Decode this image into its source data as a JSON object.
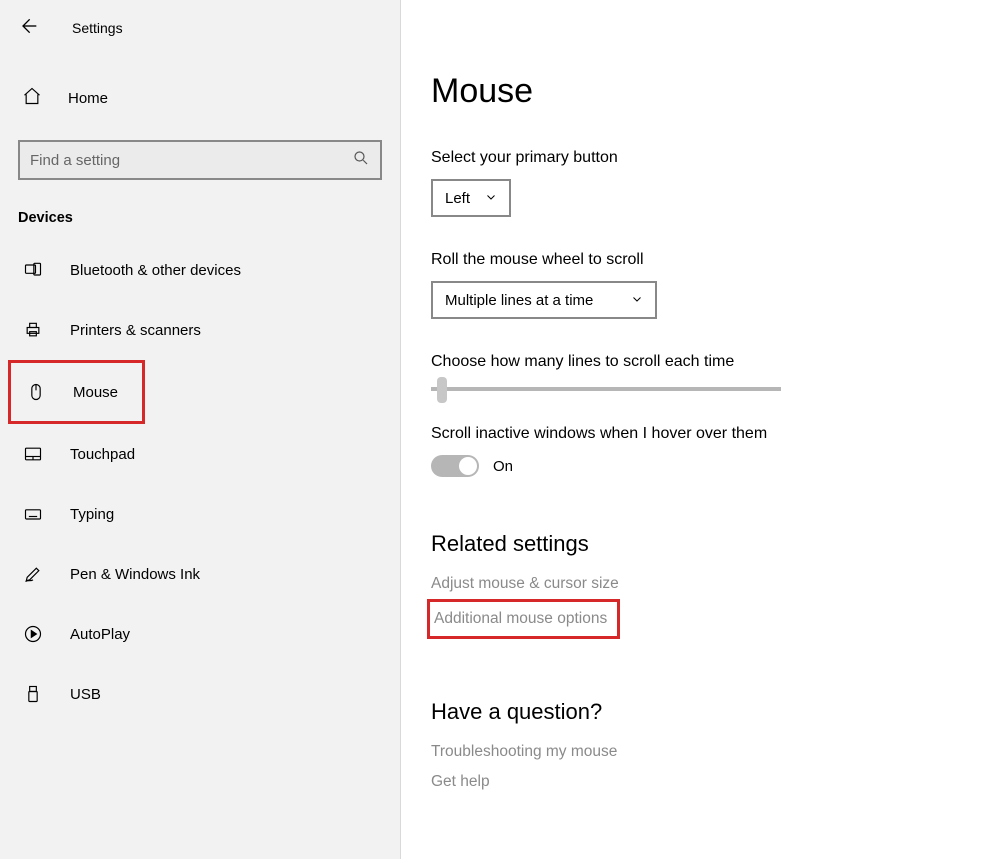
{
  "header": {
    "title": "Settings"
  },
  "home": {
    "label": "Home"
  },
  "search": {
    "placeholder": "Find a setting"
  },
  "section": {
    "label": "Devices"
  },
  "nav": {
    "items": [
      {
        "label": "Bluetooth & other devices"
      },
      {
        "label": "Printers & scanners"
      },
      {
        "label": "Mouse"
      },
      {
        "label": "Touchpad"
      },
      {
        "label": "Typing"
      },
      {
        "label": "Pen & Windows Ink"
      },
      {
        "label": "AutoPlay"
      },
      {
        "label": "USB"
      }
    ]
  },
  "page": {
    "title": "Mouse",
    "primary_button": {
      "label": "Select your primary button",
      "value": "Left"
    },
    "wheel_scroll": {
      "label": "Roll the mouse wheel to scroll",
      "value": "Multiple lines at a time"
    },
    "lines_each": {
      "label": "Choose how many lines to scroll each time"
    },
    "inactive": {
      "label": "Scroll inactive windows when I hover over them",
      "state": "On"
    },
    "related": {
      "heading": "Related settings",
      "links": [
        "Adjust mouse & cursor size",
        "Additional mouse options"
      ]
    },
    "question": {
      "heading": "Have a question?",
      "links": [
        "Troubleshooting my mouse",
        "Get help"
      ]
    }
  }
}
